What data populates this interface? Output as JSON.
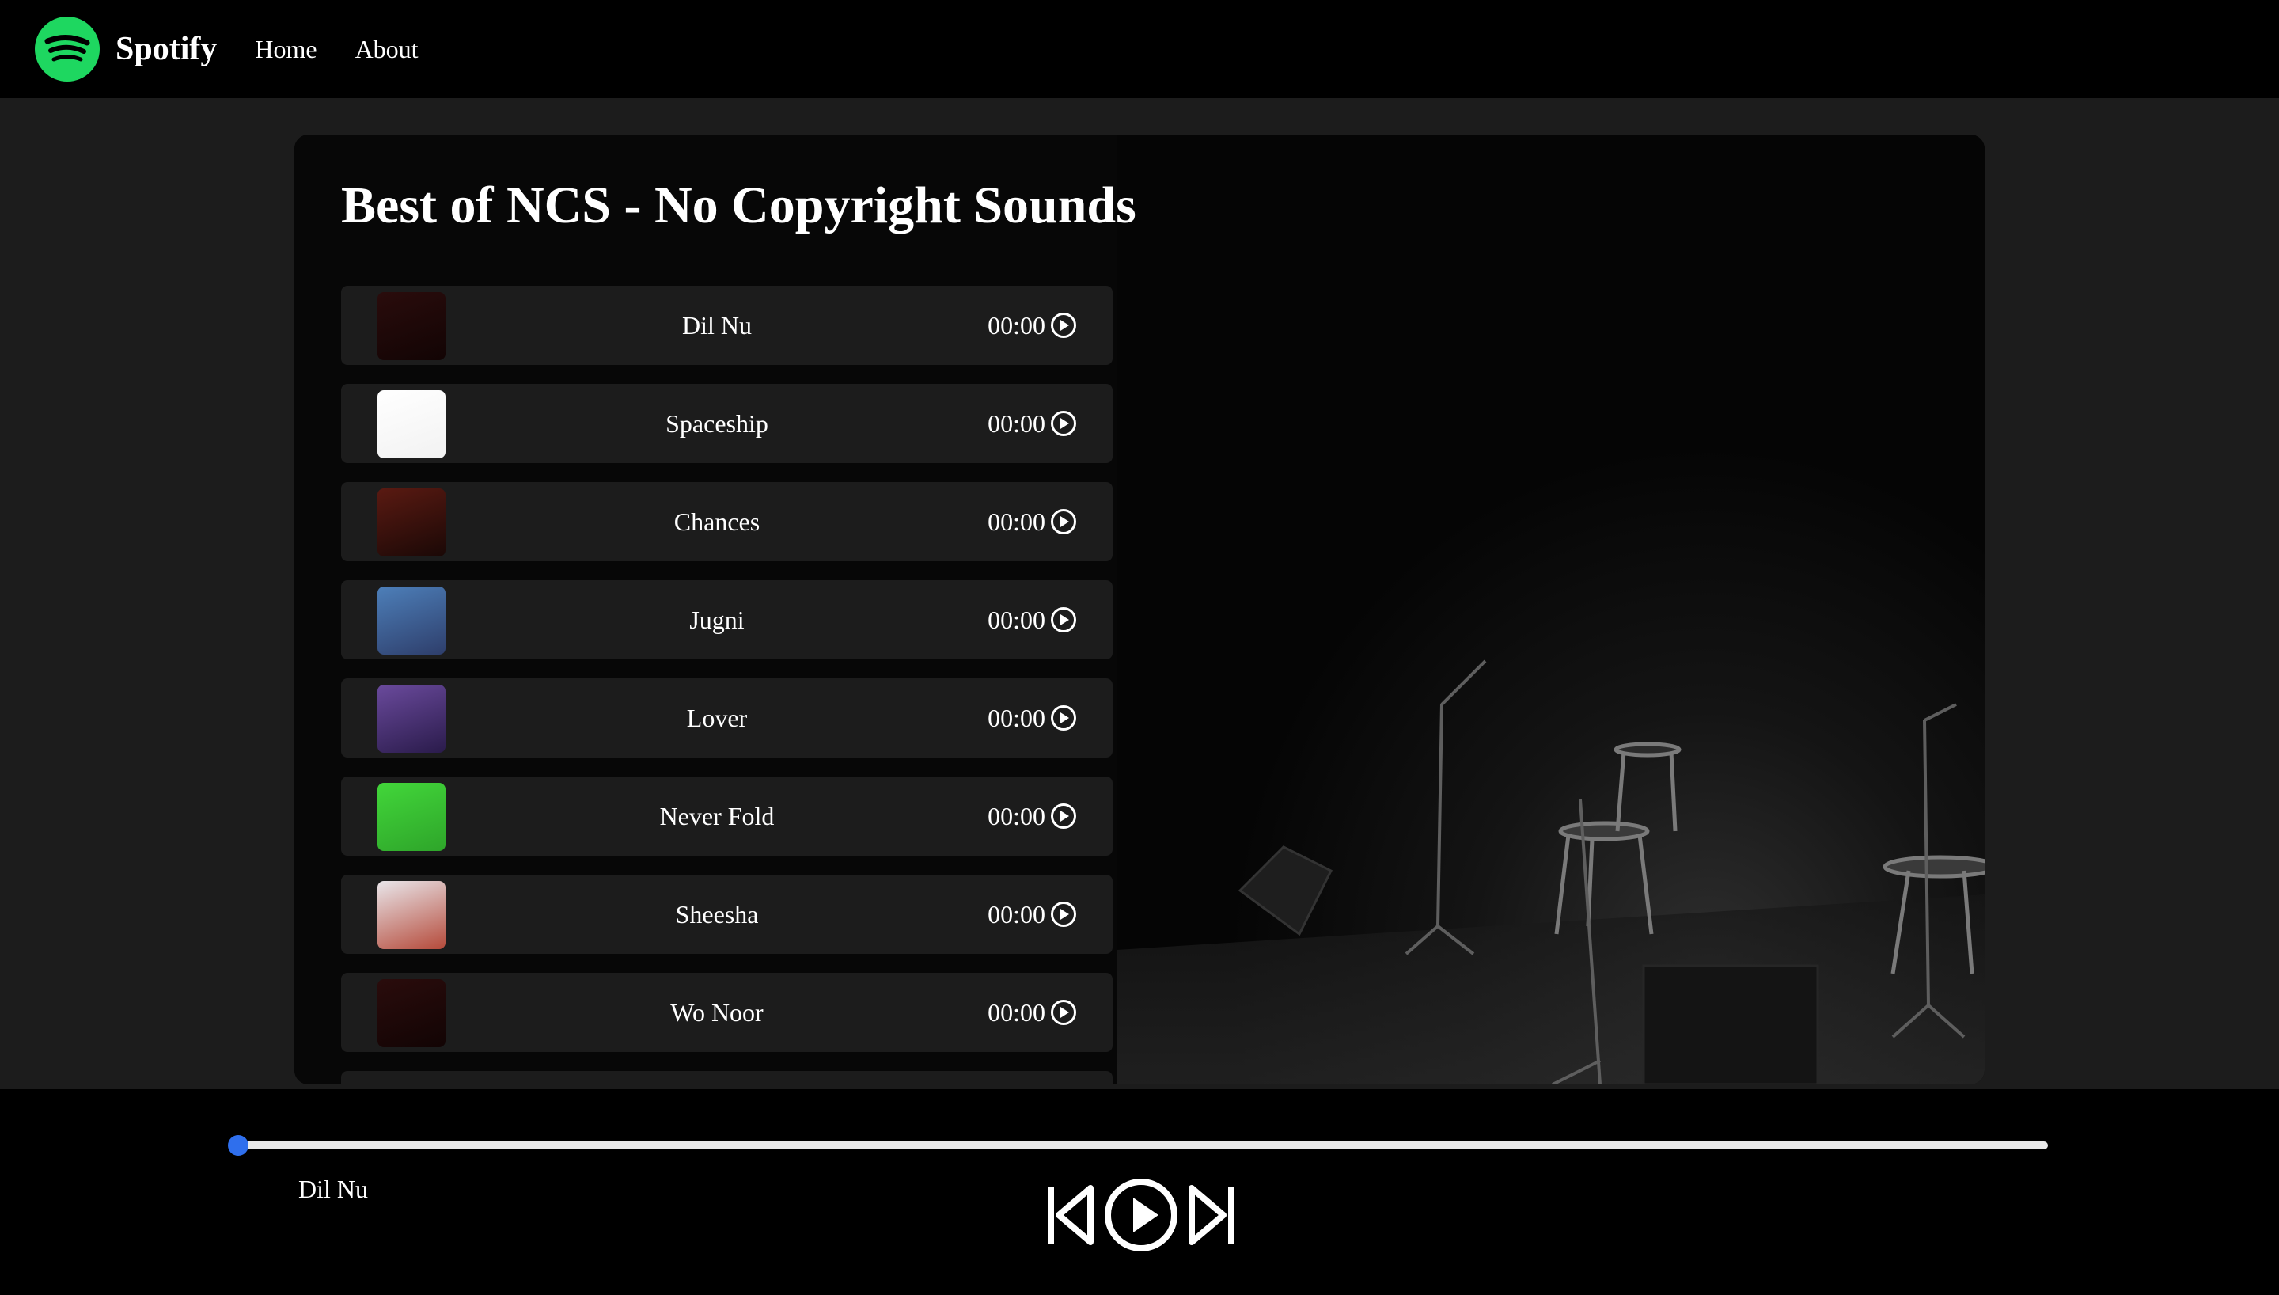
{
  "nav": {
    "brand": "Spotify",
    "links": [
      "Home",
      "About"
    ]
  },
  "playlist": {
    "title": "Best of NCS - No Copyright Sounds",
    "songs": [
      {
        "name": "Dil Nu",
        "time": "00:00",
        "cover_colors": [
          "#2a0c0c",
          "#120404"
        ]
      },
      {
        "name": "Spaceship",
        "time": "00:00",
        "cover_colors": [
          "#ffffff",
          "#f2f2f2"
        ]
      },
      {
        "name": "Chances",
        "time": "00:00",
        "cover_colors": [
          "#5a1a12",
          "#1a0806"
        ]
      },
      {
        "name": "Jugni",
        "time": "00:00",
        "cover_colors": [
          "#4d7fb9",
          "#2e3e6b"
        ]
      },
      {
        "name": "Lover",
        "time": "00:00",
        "cover_colors": [
          "#6a4a9c",
          "#2a1b4b"
        ]
      },
      {
        "name": "Never Fold",
        "time": "00:00",
        "cover_colors": [
          "#42d63a",
          "#2ea52a"
        ]
      },
      {
        "name": "Sheesha",
        "time": "00:00",
        "cover_colors": [
          "#e9e6ea",
          "#b54a3a"
        ]
      },
      {
        "name": "Wo Noor",
        "time": "00:00",
        "cover_colors": [
          "#2a0c0c",
          "#120404"
        ]
      }
    ]
  },
  "player": {
    "current_song": "Dil Nu",
    "progress": 0
  },
  "colors": {
    "accent": "#1ed760",
    "progress_thumb": "#2f6fed"
  }
}
